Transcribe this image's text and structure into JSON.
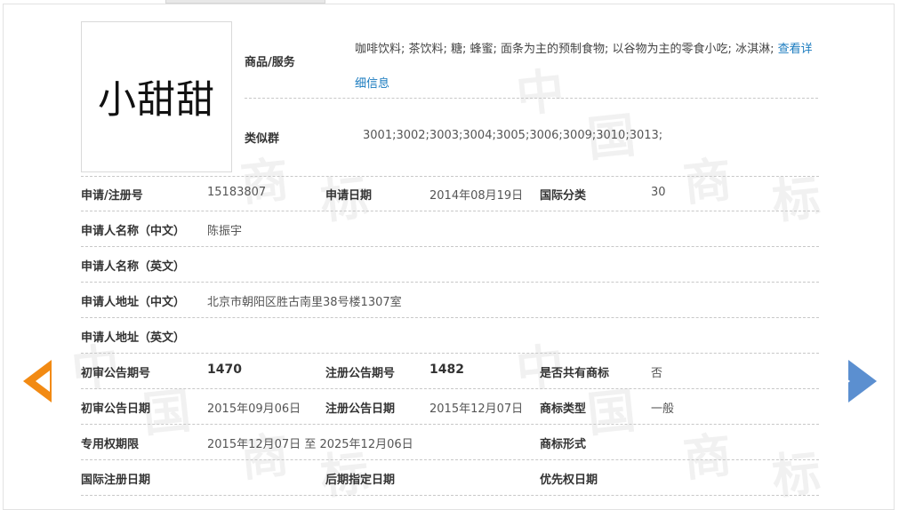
{
  "trademark": {
    "name": "小甜甜"
  },
  "goods_services": {
    "label": "商品/服务",
    "text": "咖啡饮料; 茶饮料; 糖; 蜂蜜; 面条为主的预制食物; 以谷物为主的零食小吃; 冰淇淋; ",
    "link": "查看详细信息"
  },
  "similar_group": {
    "label": "类似群",
    "value": "3001;3002;3003;3004;3005;3006;3009;3010;3013;"
  },
  "rows": {
    "reg_no": {
      "label": "申请/注册号",
      "value": "15183807"
    },
    "apply_date": {
      "label": "申请日期",
      "value": "2014年08月19日"
    },
    "intl_class": {
      "label": "国际分类",
      "value": "30"
    },
    "applicant_cn": {
      "label": "申请人名称（中文）",
      "value": "陈振宇"
    },
    "applicant_en": {
      "label": "申请人名称（英文）",
      "value": ""
    },
    "address_cn": {
      "label": "申请人地址（中文）",
      "value": "北京市朝阳区胜古南里38号楼1307室"
    },
    "address_en": {
      "label": "申请人地址（英文）",
      "value": ""
    },
    "prelim_issue": {
      "label": "初审公告期号",
      "value": "1470"
    },
    "reg_issue": {
      "label": "注册公告期号",
      "value": "1482"
    },
    "shared": {
      "label": "是否共有商标",
      "value": "否"
    },
    "prelim_date": {
      "label": "初审公告日期",
      "value": "2015年09月06日"
    },
    "reg_date": {
      "label": "注册公告日期",
      "value": "2015年12月07日"
    },
    "tm_type": {
      "label": "商标类型",
      "value": "一般"
    },
    "exclusive_period": {
      "label": "专用权期限",
      "from": "2015年12月07日",
      "sep": "至",
      "to": "2025年12月06日"
    },
    "tm_form": {
      "label": "商标形式",
      "value": ""
    },
    "intl_reg_date": {
      "label": "国际注册日期",
      "value": ""
    },
    "later_date": {
      "label": "后期指定日期",
      "value": ""
    },
    "priority_date": {
      "label": "优先权日期",
      "value": ""
    }
  },
  "watermark": {
    "chars": [
      "中",
      "国",
      "商",
      "标"
    ]
  },
  "nav": {
    "prev_icon": "arrow-left-icon",
    "next_icon": "arrow-right-icon",
    "prev_color": "#f28a13",
    "next_color": "#5b8fd0"
  }
}
